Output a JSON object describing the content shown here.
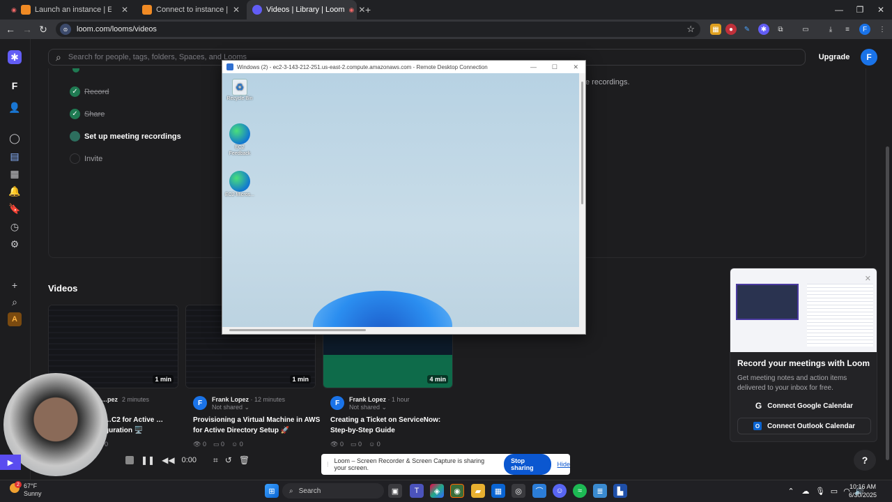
{
  "browser": {
    "tabs": [
      {
        "title": "Launch an instance | EC2 | us-e",
        "active": false
      },
      {
        "title": "Connect to instance | EC2 | us-e",
        "active": false
      },
      {
        "title": "Videos | Library | Loom",
        "active": true
      }
    ],
    "url": "loom.com/looms/videos"
  },
  "loom": {
    "search_placeholder": "Search for people, tags, folders, Spaces, and Looms",
    "upgrade_label": "Upgrade",
    "user_initial": "F",
    "workspace_initial": "F",
    "workspace_badge": "A",
    "recordings_fragment": "e recordings.",
    "checklist": [
      {
        "label": "Record",
        "done": true
      },
      {
        "label": "Share",
        "done": true
      },
      {
        "label": "Set up meeting recordings",
        "done": false,
        "current": true
      },
      {
        "label": "Invite",
        "done": false
      }
    ],
    "videos_title": "Videos",
    "videos": [
      {
        "duration": "1 min",
        "author": "…pez",
        "age": "2 minutes",
        "title": "…C2 for Active …guration 🖥️",
        "stats": [
          "0"
        ]
      },
      {
        "duration": "1 min",
        "author": "Frank Lopez",
        "age": "12 minutes",
        "shared": "Not shared",
        "title": "Provisioning a Virtual Machine in AWS for Active Directory Setup 🚀",
        "stats": [
          "0",
          "0",
          "0"
        ]
      },
      {
        "duration": "4 min",
        "author": "Frank Lopez",
        "age": "1 hour",
        "shared": "Not shared",
        "title": "Creating a Ticket on ServiceNow: Step-by-Step Guide",
        "stats": [
          "0",
          "0",
          "0"
        ]
      }
    ],
    "promo": {
      "title": "Record your meetings with Loom",
      "body": "Get meeting notes and action items delivered to your inbox for free.",
      "google_btn": "Connect Google Calendar",
      "outlook_btn": "Connect Outlook Calendar"
    },
    "record_timer": "0:00",
    "share_message": "Loom – Screen Recorder & Screen Capture is sharing your screen.",
    "stop_sharing": "Stop sharing",
    "hide": "Hide",
    "help": "?"
  },
  "rdp": {
    "title": "Windows (2) - ec2-3-143-212-251.us-east-2.compute.amazonaws.com - Remote Desktop Connection",
    "icons": [
      "Recycle Bin",
      "EC2 Feedback",
      "EC2 Micros..."
    ]
  },
  "taskbar": {
    "weather_temp": "67°F",
    "weather_desc": "Sunny",
    "weather_badge": "2",
    "search_label": "Search",
    "time": "10:16 AM",
    "date": "6/30/2025"
  },
  "colors": {
    "accent": "#1a73e8",
    "loom_purple": "#625df5",
    "check_green": "#1f7a52"
  }
}
